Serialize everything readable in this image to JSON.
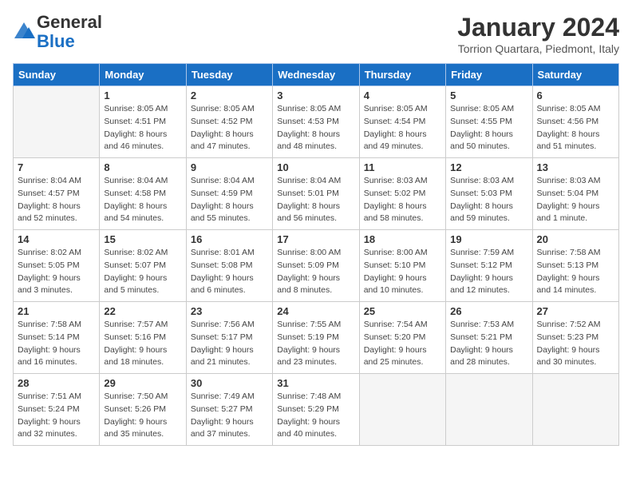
{
  "header": {
    "logo_line1": "General",
    "logo_line2": "Blue",
    "month": "January 2024",
    "location": "Torrion Quartara, Piedmont, Italy"
  },
  "columns": [
    "Sunday",
    "Monday",
    "Tuesday",
    "Wednesday",
    "Thursday",
    "Friday",
    "Saturday"
  ],
  "weeks": [
    [
      {
        "day": "",
        "empty": true
      },
      {
        "day": "1",
        "sunrise": "8:05 AM",
        "sunset": "4:51 PM",
        "daylight": "8 hours and 46 minutes."
      },
      {
        "day": "2",
        "sunrise": "8:05 AM",
        "sunset": "4:52 PM",
        "daylight": "8 hours and 47 minutes."
      },
      {
        "day": "3",
        "sunrise": "8:05 AM",
        "sunset": "4:53 PM",
        "daylight": "8 hours and 48 minutes."
      },
      {
        "day": "4",
        "sunrise": "8:05 AM",
        "sunset": "4:54 PM",
        "daylight": "8 hours and 49 minutes."
      },
      {
        "day": "5",
        "sunrise": "8:05 AM",
        "sunset": "4:55 PM",
        "daylight": "8 hours and 50 minutes."
      },
      {
        "day": "6",
        "sunrise": "8:05 AM",
        "sunset": "4:56 PM",
        "daylight": "8 hours and 51 minutes."
      }
    ],
    [
      {
        "day": "7",
        "sunrise": "8:04 AM",
        "sunset": "4:57 PM",
        "daylight": "8 hours and 52 minutes."
      },
      {
        "day": "8",
        "sunrise": "8:04 AM",
        "sunset": "4:58 PM",
        "daylight": "8 hours and 54 minutes."
      },
      {
        "day": "9",
        "sunrise": "8:04 AM",
        "sunset": "4:59 PM",
        "daylight": "8 hours and 55 minutes."
      },
      {
        "day": "10",
        "sunrise": "8:04 AM",
        "sunset": "5:01 PM",
        "daylight": "8 hours and 56 minutes."
      },
      {
        "day": "11",
        "sunrise": "8:03 AM",
        "sunset": "5:02 PM",
        "daylight": "8 hours and 58 minutes."
      },
      {
        "day": "12",
        "sunrise": "8:03 AM",
        "sunset": "5:03 PM",
        "daylight": "8 hours and 59 minutes."
      },
      {
        "day": "13",
        "sunrise": "8:03 AM",
        "sunset": "5:04 PM",
        "daylight": "9 hours and 1 minute."
      }
    ],
    [
      {
        "day": "14",
        "sunrise": "8:02 AM",
        "sunset": "5:05 PM",
        "daylight": "9 hours and 3 minutes."
      },
      {
        "day": "15",
        "sunrise": "8:02 AM",
        "sunset": "5:07 PM",
        "daylight": "9 hours and 5 minutes."
      },
      {
        "day": "16",
        "sunrise": "8:01 AM",
        "sunset": "5:08 PM",
        "daylight": "9 hours and 6 minutes."
      },
      {
        "day": "17",
        "sunrise": "8:00 AM",
        "sunset": "5:09 PM",
        "daylight": "9 hours and 8 minutes."
      },
      {
        "day": "18",
        "sunrise": "8:00 AM",
        "sunset": "5:10 PM",
        "daylight": "9 hours and 10 minutes."
      },
      {
        "day": "19",
        "sunrise": "7:59 AM",
        "sunset": "5:12 PM",
        "daylight": "9 hours and 12 minutes."
      },
      {
        "day": "20",
        "sunrise": "7:58 AM",
        "sunset": "5:13 PM",
        "daylight": "9 hours and 14 minutes."
      }
    ],
    [
      {
        "day": "21",
        "sunrise": "7:58 AM",
        "sunset": "5:14 PM",
        "daylight": "9 hours and 16 minutes."
      },
      {
        "day": "22",
        "sunrise": "7:57 AM",
        "sunset": "5:16 PM",
        "daylight": "9 hours and 18 minutes."
      },
      {
        "day": "23",
        "sunrise": "7:56 AM",
        "sunset": "5:17 PM",
        "daylight": "9 hours and 21 minutes."
      },
      {
        "day": "24",
        "sunrise": "7:55 AM",
        "sunset": "5:19 PM",
        "daylight": "9 hours and 23 minutes."
      },
      {
        "day": "25",
        "sunrise": "7:54 AM",
        "sunset": "5:20 PM",
        "daylight": "9 hours and 25 minutes."
      },
      {
        "day": "26",
        "sunrise": "7:53 AM",
        "sunset": "5:21 PM",
        "daylight": "9 hours and 28 minutes."
      },
      {
        "day": "27",
        "sunrise": "7:52 AM",
        "sunset": "5:23 PM",
        "daylight": "9 hours and 30 minutes."
      }
    ],
    [
      {
        "day": "28",
        "sunrise": "7:51 AM",
        "sunset": "5:24 PM",
        "daylight": "9 hours and 32 minutes."
      },
      {
        "day": "29",
        "sunrise": "7:50 AM",
        "sunset": "5:26 PM",
        "daylight": "9 hours and 35 minutes."
      },
      {
        "day": "30",
        "sunrise": "7:49 AM",
        "sunset": "5:27 PM",
        "daylight": "9 hours and 37 minutes."
      },
      {
        "day": "31",
        "sunrise": "7:48 AM",
        "sunset": "5:29 PM",
        "daylight": "9 hours and 40 minutes."
      },
      {
        "day": "",
        "empty": true
      },
      {
        "day": "",
        "empty": true
      },
      {
        "day": "",
        "empty": true
      }
    ]
  ]
}
